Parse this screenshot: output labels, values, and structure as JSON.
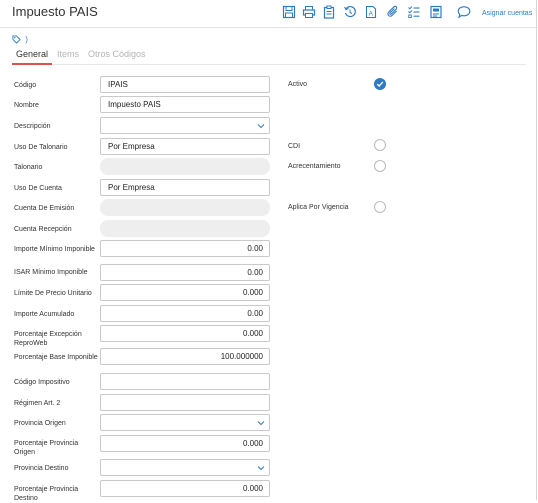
{
  "window": {
    "title": "Impuesto PAIS"
  },
  "toolbar": {
    "icons": [
      "save-icon",
      "print-icon",
      "clipboard-icon",
      "history-icon",
      "document-a-icon",
      "attachment-icon",
      "checklist-icon",
      "notes-icon",
      "comment-icon"
    ],
    "assign_label": "Asignar cuentas"
  },
  "tag_text": ")",
  "tabs": [
    {
      "label": "General",
      "active": true
    },
    {
      "label": "Items",
      "active": false
    },
    {
      "label": "Otros Códigos",
      "active": false
    }
  ],
  "form": {
    "codigo": {
      "label": "Código",
      "value": "IPAIS"
    },
    "nombre": {
      "label": "Nombre",
      "value": "Impuesto PAIS"
    },
    "descripcion": {
      "label": "Descripción",
      "value": ""
    },
    "uso_talonario": {
      "label": "Uso De Talonario",
      "value": "Por Empresa"
    },
    "talonario": {
      "label": "Talonario",
      "value": ""
    },
    "uso_cuenta": {
      "label": "Uso De Cuenta",
      "value": "Por Empresa"
    },
    "cuenta_emision": {
      "label": "Cuenta De Emisión",
      "value": ""
    },
    "cuenta_recepcion": {
      "label": "Cuenta Recepción",
      "value": ""
    },
    "importe_minimo": {
      "label": "Importe Mínimo Imponible",
      "value": "0.00"
    },
    "isar_minimo": {
      "label": "ISAR Mínimo Imponible",
      "value": "0.00"
    },
    "limite_precio": {
      "label": "Límite De Precio Unitario",
      "value": "0.000"
    },
    "importe_acumulado": {
      "label": "Importe Acumulado",
      "value": "0.00"
    },
    "porcentaje_excepcion": {
      "label": "Porcentaje Excepción ReproWeb",
      "value": "0.000"
    },
    "porcentaje_base": {
      "label": "Porcentaje Base Imponible",
      "value": "100.000000"
    },
    "codigo_impositivo": {
      "label": "Código Impositivo",
      "value": ""
    },
    "regimen": {
      "label": "Régimen Art. 2",
      "value": ""
    },
    "provincia_origen": {
      "label": "Provincia Origen",
      "value": ""
    },
    "porcentaje_prov_origen": {
      "label": "Porcentaje Provincia Origen",
      "value": "0.000"
    },
    "provincia_destino": {
      "label": "Provincia Destino",
      "value": ""
    },
    "porcentaje_prov_destino": {
      "label": "Porcentaje Provincia Destino",
      "value": "0.000"
    }
  },
  "right": {
    "activo": {
      "label": "Activo",
      "checked": true
    },
    "cdi": {
      "label": "CDI",
      "checked": false
    },
    "acrecentamiento": {
      "label": "Acrecentamiento",
      "checked": false
    },
    "aplica_vigencia": {
      "label": "Aplica Por Vigencia",
      "checked": false
    }
  },
  "colors": {
    "accent": "#2d7bc4",
    "tab_underline": "#d9534f"
  }
}
